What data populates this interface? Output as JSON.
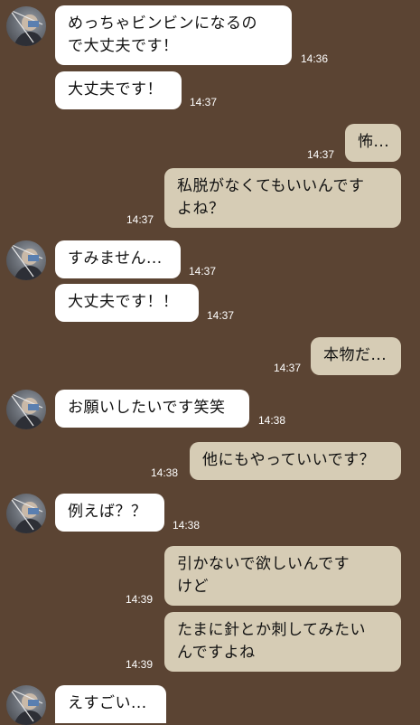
{
  "messages": [
    {
      "side": "in",
      "text": "めっちゃビンビンになるの\nで大丈夫です！",
      "time": "14:36"
    },
    {
      "side": "in",
      "text": "大丈夫です！",
      "time": "14:37"
    },
    {
      "side": "out",
      "text": "怖...",
      "time": "14:37"
    },
    {
      "side": "out",
      "text": "私脱がなくてもいいんです\nよね？",
      "time": "14:37"
    },
    {
      "side": "in",
      "text": "すみません...",
      "time": "14:37"
    },
    {
      "side": "in",
      "text": "大丈夫です！！",
      "time": "14:37"
    },
    {
      "side": "out",
      "text": "本物だ...",
      "time": "14:37"
    },
    {
      "side": "in",
      "text": "お願いしたいです笑笑",
      "time": "14:38"
    },
    {
      "side": "out",
      "text": "他にもやっていいです？",
      "time": "14:38"
    },
    {
      "side": "in",
      "text": "例えば？？",
      "time": "14:38"
    },
    {
      "side": "out",
      "text": "引かないで欲しいんです\nけど",
      "time": "14:39"
    },
    {
      "side": "out",
      "text": "たまに針とか刺してみたい\nんですよね",
      "time": "14:39"
    },
    {
      "side": "in",
      "text": "えすごい...",
      "time": ""
    }
  ]
}
